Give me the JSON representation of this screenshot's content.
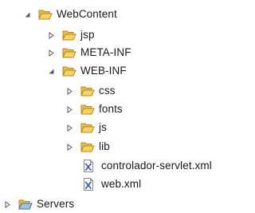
{
  "tree": {
    "items": [
      {
        "label": "WebContent",
        "kind": "folder",
        "state": "expanded"
      },
      {
        "label": "jsp",
        "kind": "folder",
        "state": "collapsed"
      },
      {
        "label": "META-INF",
        "kind": "folder",
        "state": "collapsed"
      },
      {
        "label": "WEB-INF",
        "kind": "folder",
        "state": "expanded"
      },
      {
        "label": "css",
        "kind": "folder",
        "state": "collapsed"
      },
      {
        "label": "fonts",
        "kind": "folder",
        "state": "collapsed"
      },
      {
        "label": "js",
        "kind": "folder",
        "state": "collapsed"
      },
      {
        "label": "lib",
        "kind": "folder",
        "state": "collapsed"
      },
      {
        "label": "controlador-servlet.xml",
        "kind": "xml-file",
        "state": "leaf"
      },
      {
        "label": "web.xml",
        "kind": "xml-file",
        "state": "leaf"
      },
      {
        "label": "Servers",
        "kind": "servers-folder",
        "state": "collapsed"
      }
    ]
  },
  "colors": {
    "folder_fill": "#f5d36b",
    "folder_stroke": "#b58a1b",
    "folder_back": "#e9bf45",
    "servers_fill": "#9ec4ea",
    "servers_stroke": "#3f6fa8",
    "xml_blue": "#3a63b8",
    "twisty": "#595959"
  }
}
